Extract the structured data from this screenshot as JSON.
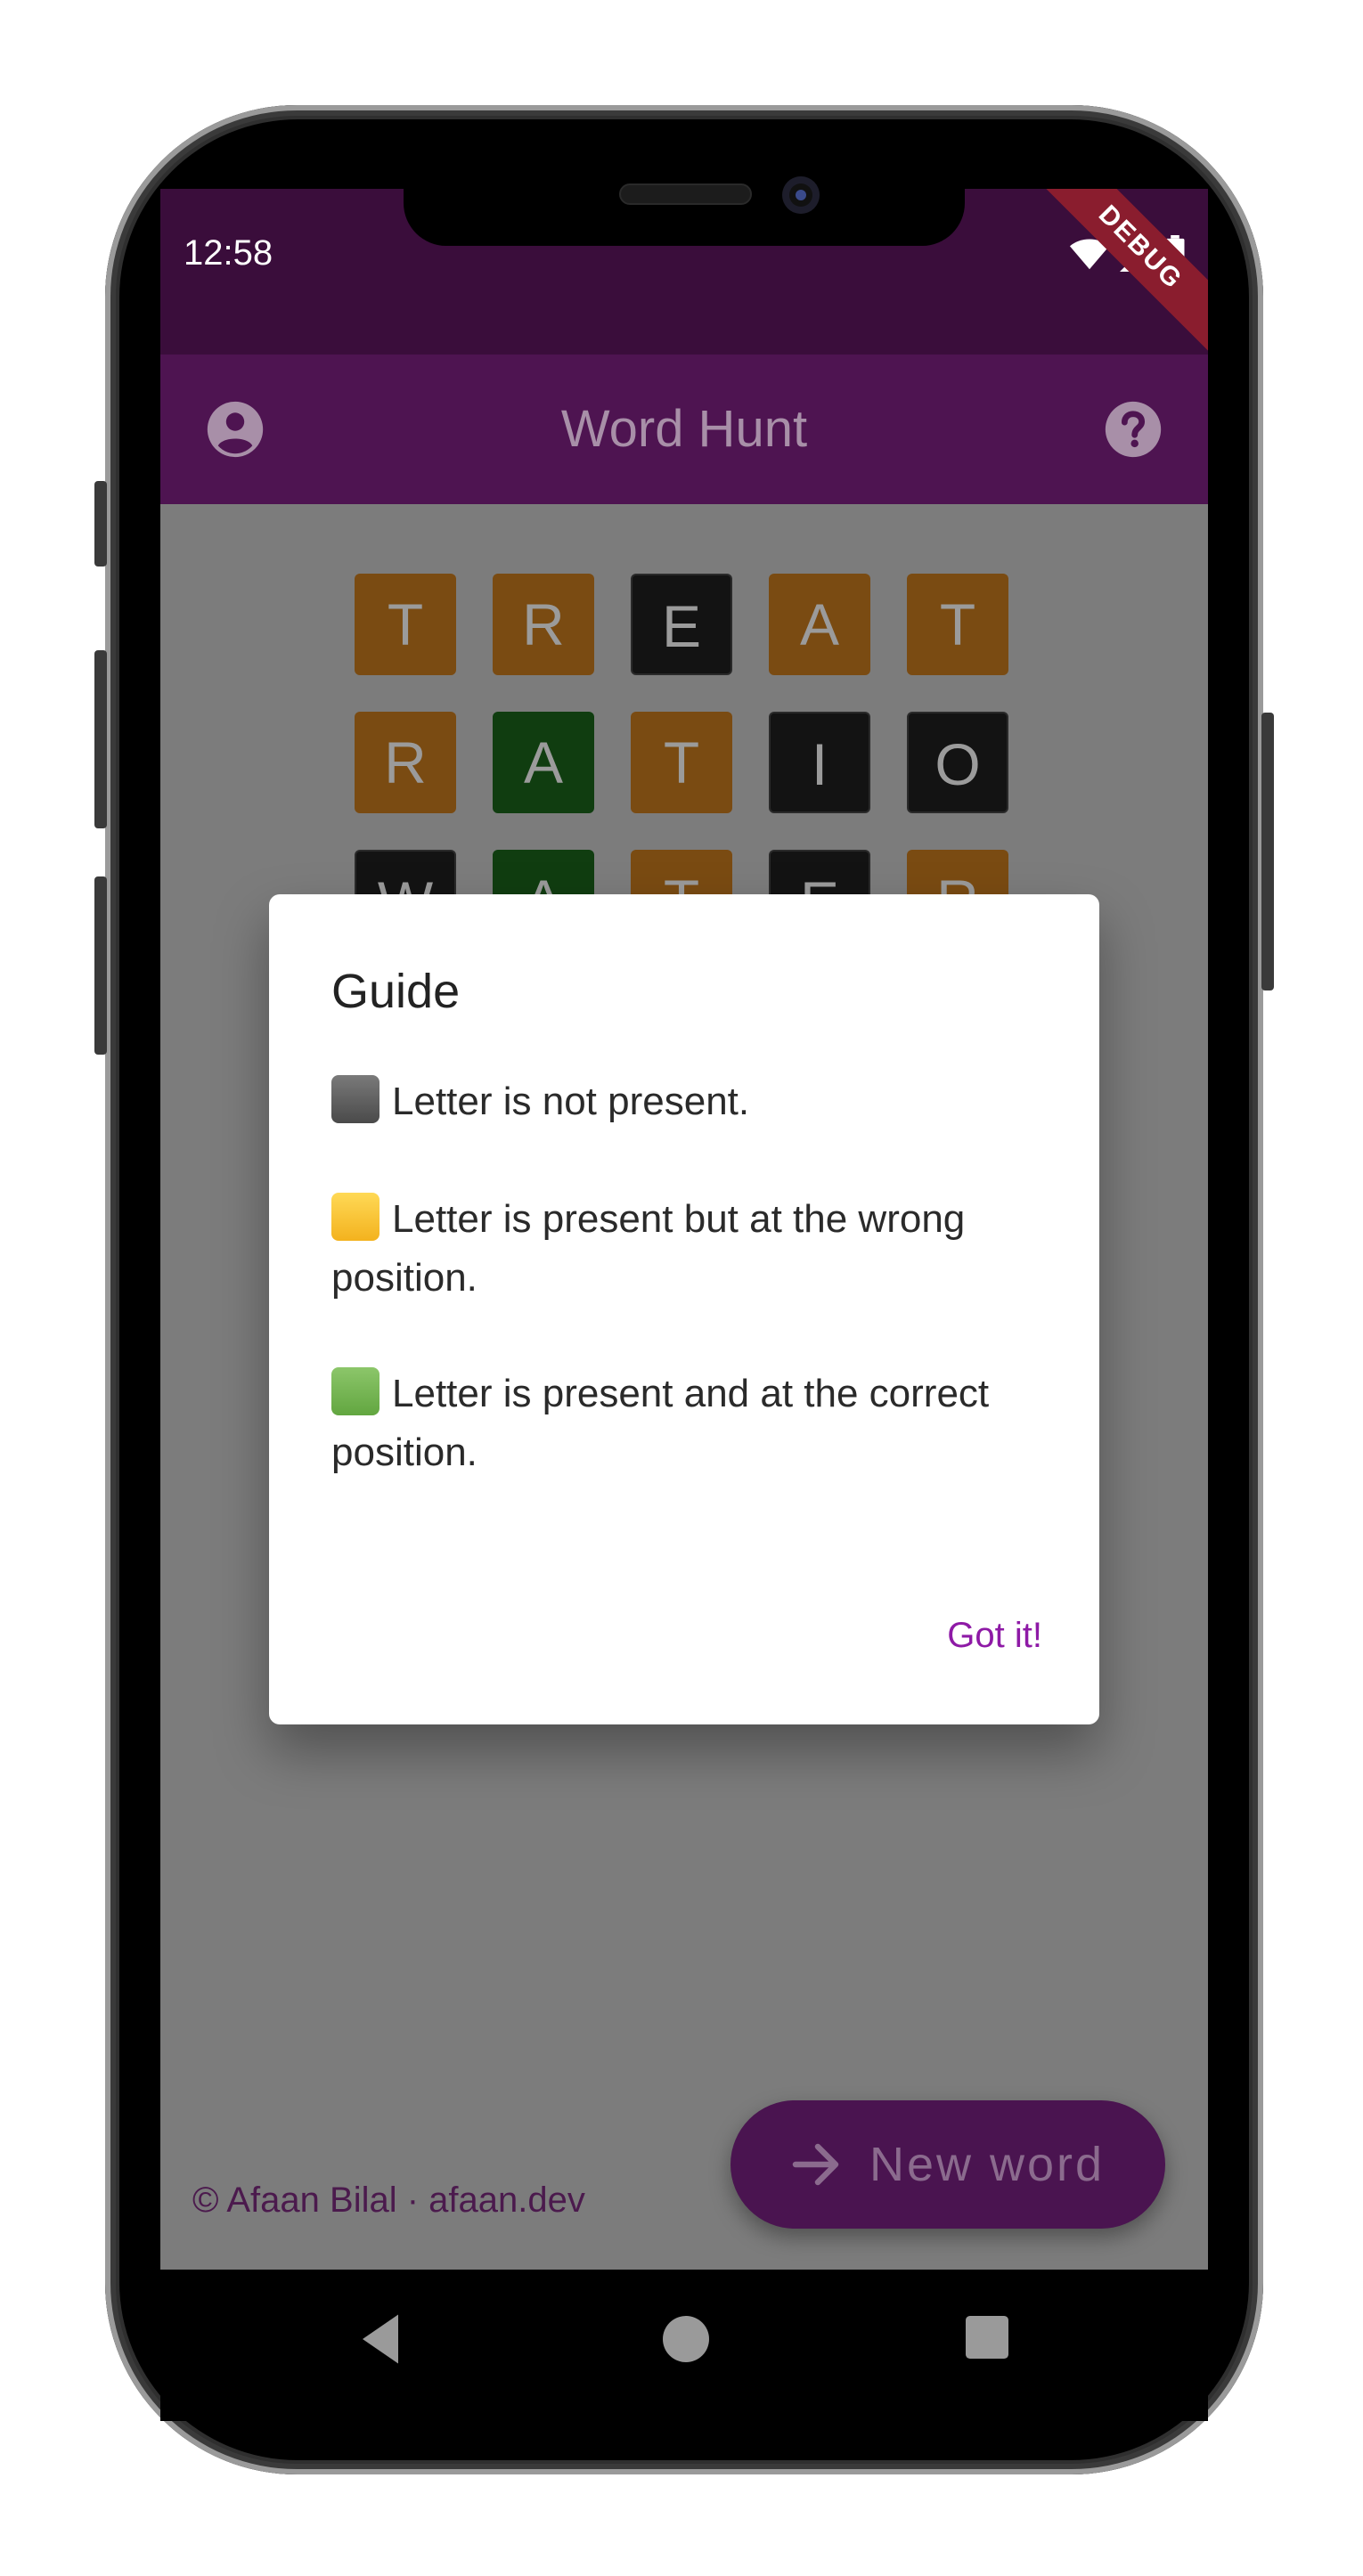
{
  "status_bar": {
    "time": "12:58",
    "debug_label": "DEBUG"
  },
  "app_bar": {
    "title": "Word Hunt"
  },
  "grid": {
    "rows": [
      [
        {
          "letter": "T",
          "state": "orange"
        },
        {
          "letter": "R",
          "state": "orange"
        },
        {
          "letter": "E",
          "state": "black"
        },
        {
          "letter": "A",
          "state": "orange"
        },
        {
          "letter": "T",
          "state": "orange"
        }
      ],
      [
        {
          "letter": "R",
          "state": "orange"
        },
        {
          "letter": "A",
          "state": "green"
        },
        {
          "letter": "T",
          "state": "orange"
        },
        {
          "letter": "I",
          "state": "black"
        },
        {
          "letter": "O",
          "state": "black"
        }
      ],
      [
        {
          "letter": "W",
          "state": "black"
        },
        {
          "letter": "A",
          "state": "green"
        },
        {
          "letter": "T",
          "state": "orange"
        },
        {
          "letter": "E",
          "state": "black"
        },
        {
          "letter": "R",
          "state": "orange"
        }
      ]
    ]
  },
  "footer": {
    "credit": "© Afaan Bilal · afaan.dev"
  },
  "fab": {
    "label": "New word"
  },
  "dialog": {
    "title": "Guide",
    "items": [
      "Letter is not present.",
      "Letter is present but at the wrong position.",
      "Letter is present and at the correct position."
    ],
    "button_label": "Got it!"
  },
  "colors": {
    "primary": "#4e1451",
    "status_bar": "#3a0d3b",
    "dialog_action": "#8e1aa6",
    "tile_orange": "#7a4b12",
    "tile_green": "#103d10",
    "tile_black": "#131313"
  }
}
